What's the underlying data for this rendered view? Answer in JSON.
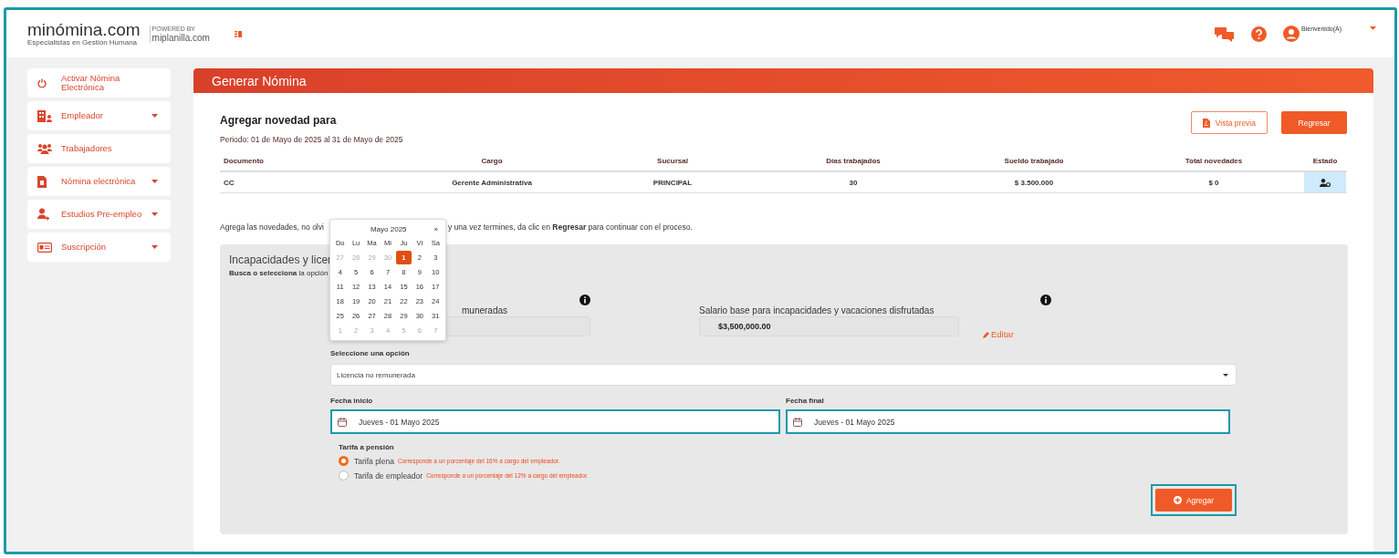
{
  "header": {
    "logo": "minómina.com",
    "tagline": "Especialistas en Gestión Humana",
    "powered_by": "POWERED BY",
    "partner": "miplanilla.com",
    "user": "Bienvenido(A)"
  },
  "sidebar": {
    "items": [
      {
        "label": "Activar Nómina Electrónica",
        "has_caret": false
      },
      {
        "label": "Empleador",
        "has_caret": true
      },
      {
        "label": "Trabajadores",
        "has_caret": false
      },
      {
        "label": "Nómina electrónica",
        "has_caret": true
      },
      {
        "label": "Estudios Pre-empleo",
        "has_caret": true
      },
      {
        "label": "Suscripción",
        "has_caret": true
      }
    ]
  },
  "card": {
    "title": "Generar Nómina",
    "heading": "Agregar novedad para",
    "period": "Periodo: 01 de Mayo de 2025 al 31 de Mayo de 2025",
    "buttons": [
      {
        "label": "Vista previa",
        "kind": "outline"
      },
      {
        "label": "Regresar",
        "kind": "primary"
      }
    ]
  },
  "table": {
    "columns": [
      "Documento",
      "Cargo",
      "Sucursal",
      "Días trabajados",
      "Sueldo trabajado",
      "Total novedades",
      "Estado"
    ],
    "rows": [
      {
        "cells": [
          "CC",
          "Gerente Administrativa",
          "PRINCIPAL",
          "30",
          "$ 3.500.000",
          "$ 0"
        ],
        "status_icon": true
      }
    ]
  },
  "instructions": {
    "before": "Agrega las novedades, no olvi",
    "after": "y una vez termines, da clic en **Regresar** para continuar con el proceso."
  },
  "panel": {
    "title": "Incapacidades y licer",
    "subtitle": "**Busca o selecciona** la opción",
    "left_field": {
      "label": "muneradas"
    },
    "right_field": {
      "label": "Salario base para incapacidades y vacaciones disfrutadas",
      "value": "$3,500,000.00",
      "link": "Editar"
    },
    "select": {
      "label": "Seleccione una opción",
      "value": "Licencia no remunerada"
    },
    "dates": [
      {
        "label": "Fecha inicio",
        "value": "Jueves - 01 Mayo 2025",
        "highlighted": true
      },
      {
        "label": "Fecha final",
        "value": "Jueves - 01 Mayo 2025",
        "highlighted": true
      }
    ],
    "pension": {
      "label": "Tarifa a pensión",
      "options": [
        {
          "label": "Tarifa plena",
          "note": "Corresponde a un porcentaje del 16% a cargo del empleador.",
          "selected": true
        },
        {
          "label": "Tarifa de empleador",
          "note": "Corresponde a un porcentaje del 12% a cargo del empleador.",
          "selected": false
        }
      ]
    },
    "add_button": {
      "label": "Agregar",
      "highlighted": true
    }
  },
  "datepicker": {
    "month": "Mayo 2025",
    "next": "»",
    "weekdays": [
      "Do",
      "Lu",
      "Ma",
      "Mi",
      "Ju",
      "Vi",
      "Sa"
    ],
    "weeks": [
      [
        {
          "day": "27",
          "muted": true,
          "selected": false
        },
        {
          "day": "28",
          "muted": true,
          "selected": false
        },
        {
          "day": "29",
          "muted": true,
          "selected": false
        },
        {
          "day": "30",
          "muted": true,
          "selected": false
        },
        {
          "day": "1",
          "muted": false,
          "selected": true
        },
        {
          "day": "2",
          "muted": false,
          "selected": false
        },
        {
          "day": "3",
          "muted": false,
          "selected": false
        }
      ],
      [
        {
          "day": "4",
          "muted": false,
          "selected": false
        },
        {
          "day": "5",
          "muted": false,
          "selected": false
        },
        {
          "day": "6",
          "muted": false,
          "selected": false
        },
        {
          "day": "7",
          "muted": false,
          "selected": false
        },
        {
          "day": "8",
          "muted": false,
          "selected": false
        },
        {
          "day": "9",
          "muted": false,
          "selected": false
        },
        {
          "day": "10",
          "muted": false,
          "selected": false
        }
      ],
      [
        {
          "day": "11",
          "muted": false,
          "selected": false
        },
        {
          "day": "12",
          "muted": false,
          "selected": false
        },
        {
          "day": "13",
          "muted": false,
          "selected": false
        },
        {
          "day": "14",
          "muted": false,
          "selected": false
        },
        {
          "day": "15",
          "muted": false,
          "selected": false
        },
        {
          "day": "16",
          "muted": false,
          "selected": false
        },
        {
          "day": "17",
          "muted": false,
          "selected": false
        }
      ],
      [
        {
          "day": "18",
          "muted": false,
          "selected": false
        },
        {
          "day": "19",
          "muted": false,
          "selected": false
        },
        {
          "day": "20",
          "muted": false,
          "selected": false
        },
        {
          "day": "21",
          "muted": false,
          "selected": false
        },
        {
          "day": "22",
          "muted": false,
          "selected": false
        },
        {
          "day": "23",
          "muted": false,
          "selected": false
        },
        {
          "day": "24",
          "muted": false,
          "selected": false
        }
      ],
      [
        {
          "day": "25",
          "muted": false,
          "selected": false
        },
        {
          "day": "26",
          "muted": false,
          "selected": false
        },
        {
          "day": "27",
          "muted": false,
          "selected": false
        },
        {
          "day": "28",
          "muted": false,
          "selected": false
        },
        {
          "day": "29",
          "muted": false,
          "selected": false
        },
        {
          "day": "30",
          "muted": false,
          "selected": false
        },
        {
          "day": "31",
          "muted": false,
          "selected": false
        }
      ],
      [
        {
          "day": "1",
          "muted": true,
          "selected": false
        },
        {
          "day": "2",
          "muted": true,
          "selected": false
        },
        {
          "day": "3",
          "muted": true,
          "selected": false
        },
        {
          "day": "4",
          "muted": true,
          "selected": false
        },
        {
          "day": "5",
          "muted": true,
          "selected": false
        },
        {
          "day": "6",
          "muted": true,
          "selected": false
        },
        {
          "day": "7",
          "muted": true,
          "selected": false
        }
      ]
    ]
  }
}
